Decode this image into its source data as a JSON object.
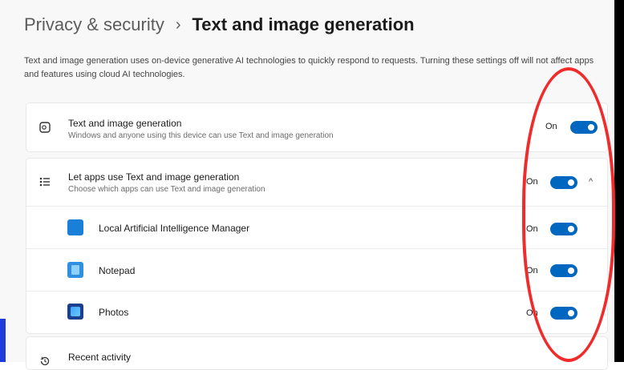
{
  "header": {
    "parent": "Privacy & security",
    "separator": "›",
    "current": "Text and image generation"
  },
  "description": "Text and image generation uses on-device generative AI technologies to quickly respond to requests. Turning these settings off will not affect apps and features using cloud AI technologies.",
  "main_setting": {
    "title": "Text and image generation",
    "subtitle": "Windows and anyone using this device can use Text and image generation",
    "state": "On",
    "icon": "image-generation-icon"
  },
  "apps_setting": {
    "title": "Let apps use Text and image generation",
    "subtitle": "Choose which apps can use Text and image generation",
    "state": "On",
    "icon": "list-icon",
    "chevron": "^",
    "apps": [
      {
        "name": "Local Artificial Intelligence Manager",
        "state": "On",
        "icon": "ai-manager-icon"
      },
      {
        "name": "Notepad",
        "state": "On",
        "icon": "notepad-icon"
      },
      {
        "name": "Photos",
        "state": "On",
        "icon": "photos-icon"
      }
    ]
  },
  "recent_activity": {
    "title": "Recent activity",
    "icon": "history-icon"
  },
  "colors": {
    "toggle_on": "#0067c0",
    "annotation": "#ef2b2b"
  }
}
